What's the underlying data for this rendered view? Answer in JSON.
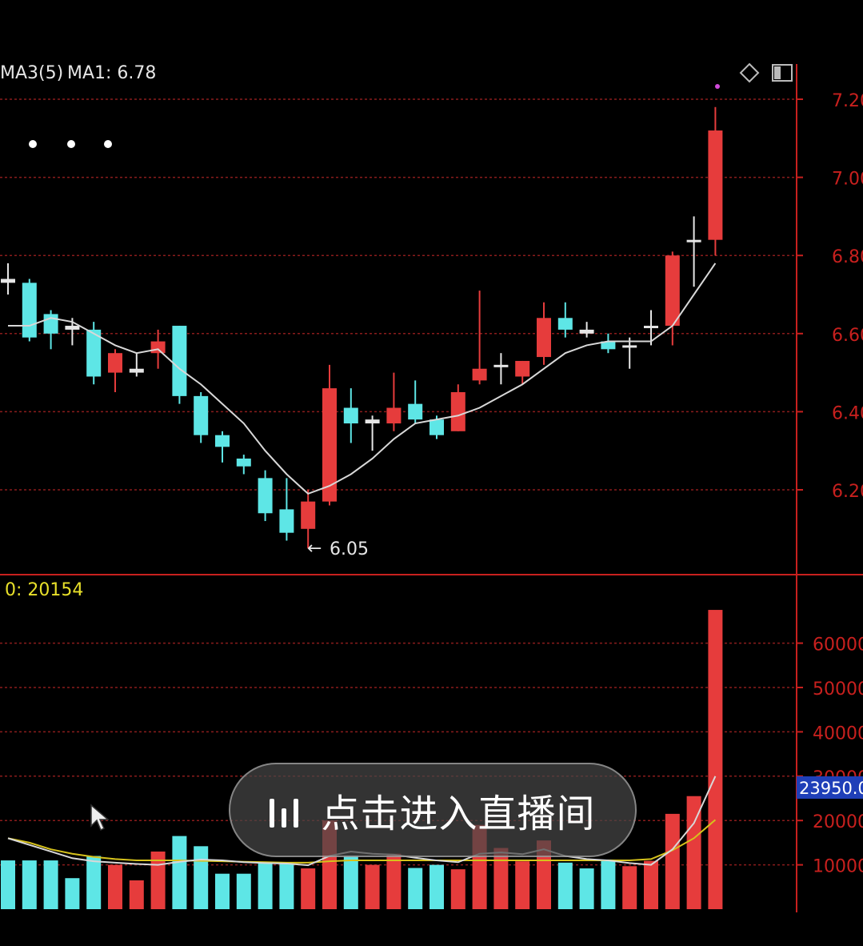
{
  "indicators": {
    "ma_label": "MA3(5)",
    "ma1_label": "MA1: 6.78",
    "volume_label": "0: 20154",
    "low_marker": "6.05",
    "volume_marker": "23950.0"
  },
  "live_button": {
    "label": "点击进入直播间",
    "icon": "audio-bars-icon"
  },
  "colors": {
    "up": "#e63c3c",
    "down": "#5ee6e6",
    "ma": "#d8d8d8",
    "vol_ma_yellow": "#d6c21c",
    "vol_ma_white": "#d8d8d8",
    "grid": "#8a1c1c",
    "axis": "#c8201e"
  },
  "chart_data": [
    {
      "type": "candlestick",
      "ylim": [
        5.95,
        7.25
      ],
      "y_ticks": [
        "7.20",
        "7.00",
        "6.80",
        "6.60",
        "6.40",
        "6.20"
      ],
      "candles": [
        {
          "o": 6.74,
          "h": 6.78,
          "l": 6.7,
          "c": 6.73
        },
        {
          "o": 6.73,
          "h": 6.74,
          "l": 6.58,
          "c": 6.59
        },
        {
          "o": 6.65,
          "h": 6.66,
          "l": 6.56,
          "c": 6.6
        },
        {
          "o": 6.62,
          "h": 6.64,
          "l": 6.57,
          "c": 6.61
        },
        {
          "o": 6.61,
          "h": 6.63,
          "l": 6.47,
          "c": 6.49
        },
        {
          "o": 6.5,
          "h": 6.56,
          "l": 6.45,
          "c": 6.55
        },
        {
          "o": 6.5,
          "h": 6.55,
          "l": 6.49,
          "c": 6.51
        },
        {
          "o": 6.55,
          "h": 6.61,
          "l": 6.51,
          "c": 6.58
        },
        {
          "o": 6.62,
          "h": 6.62,
          "l": 6.42,
          "c": 6.44
        },
        {
          "o": 6.44,
          "h": 6.45,
          "l": 6.32,
          "c": 6.34
        },
        {
          "o": 6.34,
          "h": 6.35,
          "l": 6.27,
          "c": 6.31
        },
        {
          "o": 6.28,
          "h": 6.29,
          "l": 6.24,
          "c": 6.26
        },
        {
          "o": 6.23,
          "h": 6.25,
          "l": 6.12,
          "c": 6.14
        },
        {
          "o": 6.15,
          "h": 6.23,
          "l": 6.07,
          "c": 6.09
        },
        {
          "o": 6.1,
          "h": 6.2,
          "l": 6.05,
          "c": 6.17
        },
        {
          "o": 6.17,
          "h": 6.52,
          "l": 6.16,
          "c": 6.46
        },
        {
          "o": 6.41,
          "h": 6.46,
          "l": 6.32,
          "c": 6.37
        },
        {
          "o": 6.37,
          "h": 6.39,
          "l": 6.3,
          "c": 6.38
        },
        {
          "o": 6.37,
          "h": 6.5,
          "l": 6.35,
          "c": 6.41
        },
        {
          "o": 6.42,
          "h": 6.48,
          "l": 6.37,
          "c": 6.38
        },
        {
          "o": 6.38,
          "h": 6.39,
          "l": 6.33,
          "c": 6.34
        },
        {
          "o": 6.35,
          "h": 6.47,
          "l": 6.35,
          "c": 6.45
        },
        {
          "o": 6.48,
          "h": 6.71,
          "l": 6.47,
          "c": 6.51
        },
        {
          "o": 6.52,
          "h": 6.55,
          "l": 6.47,
          "c": 6.52
        },
        {
          "o": 6.49,
          "h": 6.53,
          "l": 6.47,
          "c": 6.53
        },
        {
          "o": 6.54,
          "h": 6.68,
          "l": 6.52,
          "c": 6.64
        },
        {
          "o": 6.64,
          "h": 6.68,
          "l": 6.59,
          "c": 6.61
        },
        {
          "o": 6.61,
          "h": 6.63,
          "l": 6.59,
          "c": 6.6
        },
        {
          "o": 6.58,
          "h": 6.6,
          "l": 6.55,
          "c": 6.56
        },
        {
          "o": 6.57,
          "h": 6.59,
          "l": 6.51,
          "c": 6.57
        },
        {
          "o": 6.62,
          "h": 6.66,
          "l": 6.57,
          "c": 6.62
        },
        {
          "o": 6.62,
          "h": 6.81,
          "l": 6.57,
          "c": 6.8
        },
        {
          "o": 6.84,
          "h": 6.9,
          "l": 6.72,
          "c": 6.84
        },
        {
          "o": 6.84,
          "h": 7.18,
          "l": 6.8,
          "c": 7.12
        }
      ],
      "ma": [
        6.62,
        6.62,
        6.64,
        6.63,
        6.6,
        6.57,
        6.55,
        6.56,
        6.51,
        6.47,
        6.42,
        6.37,
        6.3,
        6.24,
        6.19,
        6.21,
        6.24,
        6.28,
        6.33,
        6.37,
        6.38,
        6.39,
        6.41,
        6.44,
        6.47,
        6.51,
        6.55,
        6.57,
        6.58,
        6.58,
        6.58,
        6.62,
        6.7,
        6.78
      ]
    },
    {
      "type": "bar",
      "ylim": [
        0,
        70000
      ],
      "y_ticks": [
        "60000",
        "50000",
        "40000",
        "30000",
        "20000",
        "10000"
      ],
      "values": [
        11000,
        11000,
        11000,
        7000,
        12000,
        10000,
        6500,
        13000,
        16500,
        14200,
        8000,
        8000,
        10700,
        10200,
        9200,
        20000,
        12000,
        10000,
        12500,
        9300,
        10000,
        9000,
        19000,
        13800,
        10800,
        15500,
        10500,
        9200,
        11200,
        9700,
        10900,
        21500,
        25500,
        67500
      ],
      "ma_yellow": [
        16000,
        15000,
        13500,
        12500,
        11800,
        11300,
        11000,
        11000,
        11000,
        10900,
        10800,
        10700,
        10600,
        10500,
        10500,
        10800,
        11000,
        11000,
        11000,
        11000,
        11000,
        11000,
        11000,
        11000,
        11000,
        11000,
        11000,
        11000,
        11000,
        11000,
        11300,
        13300,
        16000,
        20154
      ],
      "ma_white": [
        16000,
        14500,
        13000,
        11500,
        10800,
        10500,
        10200,
        10000,
        10700,
        11200,
        11000,
        10600,
        10400,
        10300,
        9900,
        12000,
        13000,
        12500,
        12300,
        11600,
        11000,
        10600,
        12500,
        12800,
        12400,
        13500,
        12000,
        11300,
        11000,
        10400,
        10000,
        13500,
        19400,
        30000
      ]
    }
  ]
}
